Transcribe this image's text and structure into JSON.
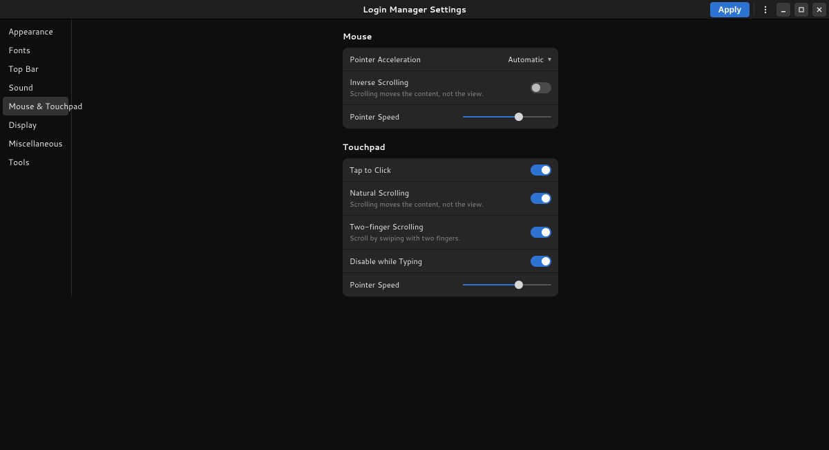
{
  "header": {
    "title": "Login Manager Settings",
    "apply_label": "Apply"
  },
  "sidebar": {
    "items": [
      {
        "label": "Appearance",
        "selected": false
      },
      {
        "label": "Fonts",
        "selected": false
      },
      {
        "label": "Top Bar",
        "selected": false
      },
      {
        "label": "Sound",
        "selected": false
      },
      {
        "label": "Mouse & Touchpad",
        "selected": true
      },
      {
        "label": "Display",
        "selected": false
      },
      {
        "label": "Miscellaneous",
        "selected": false
      },
      {
        "label": "Tools",
        "selected": false
      }
    ]
  },
  "main": {
    "mouse": {
      "title": "Mouse",
      "pointer_accel": {
        "label": "Pointer Acceleration",
        "value": "Automatic"
      },
      "inverse_scrolling": {
        "label": "Inverse Scrolling",
        "subtitle": "Scrolling moves the content, not the view.",
        "enabled": false
      },
      "pointer_speed": {
        "label": "Pointer Speed",
        "value": 0.63
      }
    },
    "touchpad": {
      "title": "Touchpad",
      "tap_to_click": {
        "label": "Tap to Click",
        "enabled": true
      },
      "natural_scrolling": {
        "label": "Natural Scrolling",
        "subtitle": "Scrolling moves the content, not the view.",
        "enabled": true
      },
      "two_finger_scrolling": {
        "label": "Two-finger Scrolling",
        "subtitle": "Scroll by swiping with two fingers.",
        "enabled": true
      },
      "disable_while_typing": {
        "label": "Disable while Typing",
        "enabled": true
      },
      "pointer_speed": {
        "label": "Pointer Speed",
        "value": 0.63
      }
    }
  }
}
